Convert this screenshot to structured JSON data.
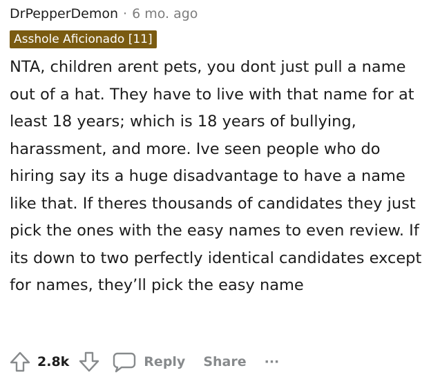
{
  "comment": {
    "username": "DrPepperDemon",
    "separator": "·",
    "age": "6 mo. ago",
    "flair": "Asshole Aficionado [11]",
    "body": "NTA, children arent pets, you dont just pull a name out of a hat. They have to live with that name for at least 18 years; which is 18 years of bullying, harassment, and more. Ive seen people who do hiring say its a huge disadvantage to have a name like that. If theres thousands of candidates they just pick the ones with the easy names to even review. If its down to two perfectly identical candidates except for names, they’ll pick the easy name"
  },
  "actions": {
    "vote_count": "2.8k",
    "reply_label": "Reply",
    "share_label": "Share",
    "more_label": "···"
  },
  "colors": {
    "flair_bg": "#7a5b11",
    "meta_gray": "#7c7c7c",
    "action_gray": "#878a8c"
  },
  "icons": {
    "upvote": "upvote-arrow-icon",
    "downvote": "downvote-arrow-icon",
    "reply": "speech-bubble-icon",
    "more": "ellipsis-icon"
  }
}
